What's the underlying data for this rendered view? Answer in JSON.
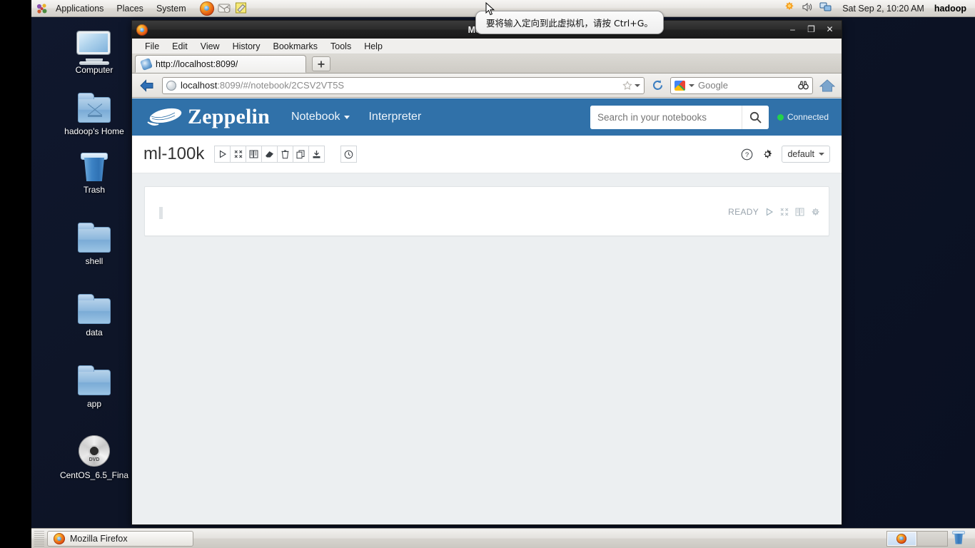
{
  "desktop": {
    "icons": [
      {
        "label": "Computer",
        "icon": "computer-icon"
      },
      {
        "label": "hadoop's Home",
        "icon": "home-folder-icon"
      },
      {
        "label": "Trash",
        "icon": "trash-icon"
      },
      {
        "label": "shell",
        "icon": "folder-icon"
      },
      {
        "label": "data",
        "icon": "folder-icon"
      },
      {
        "label": "app",
        "icon": "folder-icon"
      },
      {
        "label": "CentOS_6.5_Fina",
        "icon": "dvd-icon"
      }
    ]
  },
  "top_panel": {
    "menus": [
      "Applications",
      "Places",
      "System"
    ],
    "launchers": [
      "firefox-icon",
      "email-icon",
      "notes-icon"
    ],
    "tray": [
      "update-icon",
      "volume-icon",
      "network-icon"
    ],
    "clock": "Sat Sep  2, 10:20 AM",
    "user": "hadoop"
  },
  "vm_tooltip": {
    "text": "要将输入定向到此虚拟机，请按 Ctrl+G。"
  },
  "browser": {
    "window_title": "Mozilla F",
    "window_buttons": {
      "minimize": "–",
      "maximize": "❐",
      "close": "✕"
    },
    "menubar": [
      "File",
      "Edit",
      "View",
      "History",
      "Bookmarks",
      "Tools",
      "Help"
    ],
    "tab": {
      "title": "http://localhost:8099/",
      "favicon": "zeppelin-favicon"
    },
    "new_tab_label": "+",
    "url": {
      "host": "localhost",
      "rest": ":8099/#/notebook/2CSV2VT5S",
      "full": "localhost:8099/#/notebook/2CSV2VT5S"
    },
    "search": {
      "engine": "Google",
      "placeholder": "Google"
    }
  },
  "zeppelin": {
    "brand": "Zeppelin",
    "nav": [
      {
        "label": "Notebook",
        "has_caret": true
      },
      {
        "label": "Interpreter",
        "has_caret": false
      }
    ],
    "search_placeholder": "Search in your notebooks",
    "search_value": "",
    "connection_status": "Connected",
    "connection_color": "#24d14b",
    "navbar_color": "#3071a9",
    "notebook": {
      "title": "ml-100k",
      "toolbar": [
        {
          "name": "run-all-paragraphs-button",
          "glyph": "play"
        },
        {
          "name": "hide-show-all-code-button",
          "glyph": "collapse"
        },
        {
          "name": "show-hide-all-output-button",
          "glyph": "book"
        },
        {
          "name": "clear-all-output-button",
          "glyph": "eraser"
        },
        {
          "name": "remove-notebook-button",
          "glyph": "trash"
        },
        {
          "name": "clone-notebook-button",
          "glyph": "copy"
        },
        {
          "name": "export-notebook-button",
          "glyph": "export"
        }
      ],
      "scheduler_button": {
        "name": "run-scheduler-button",
        "glyph": "clock"
      },
      "help_button": "?",
      "settings_button": "gear",
      "interpreter_binding": "default"
    },
    "paragraph": {
      "code": "",
      "status": "READY",
      "controls": [
        {
          "name": "run-paragraph-button",
          "glyph": "play"
        },
        {
          "name": "hide-editor-button",
          "glyph": "collapse"
        },
        {
          "name": "hide-output-button",
          "glyph": "book"
        },
        {
          "name": "paragraph-settings-button",
          "glyph": "gear"
        }
      ]
    }
  },
  "taskbar": {
    "task": "Mozilla Firefox",
    "workspaces": [
      {
        "active": true,
        "name": "workspace-1"
      },
      {
        "active": false,
        "name": "workspace-2"
      }
    ],
    "trash": "trash-applet"
  }
}
